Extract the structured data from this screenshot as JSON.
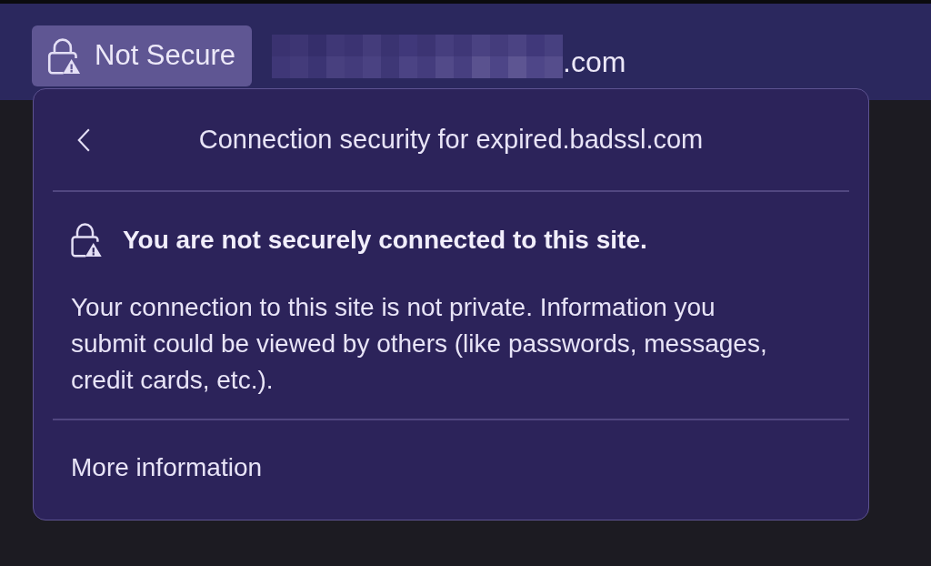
{
  "toolbar": {
    "security_button": {
      "label": "Not Secure"
    },
    "address": {
      "domain_suffix": ".com"
    }
  },
  "security_panel": {
    "title": "Connection security for expired.badssl.com",
    "status": "You are not securely connected to this site.",
    "description": "Your connection to this site is not private. Information you submit could be viewed by others (like passwords, messages, credit cards, etc.).",
    "link": "More information"
  }
}
